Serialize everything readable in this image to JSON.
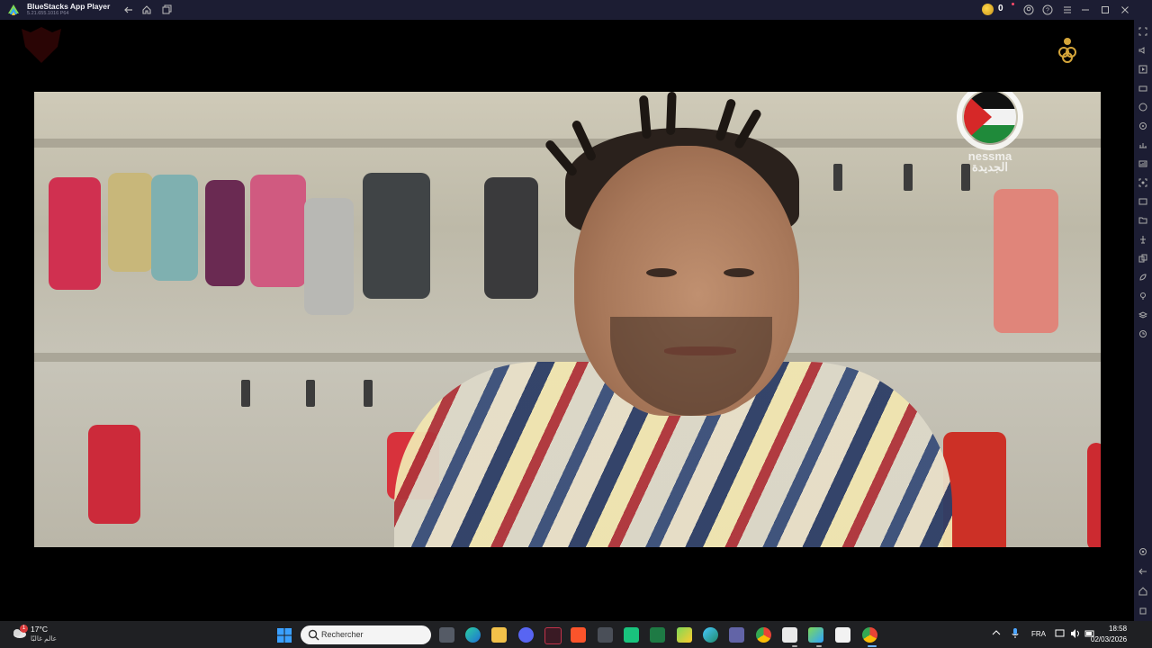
{
  "window": {
    "title": "BlueStacks App Player",
    "version": "5.21.655.1016 P64",
    "coins": "0"
  },
  "titlebar_icons": [
    "back-icon",
    "home-icon",
    "multi-instance-icon",
    "coin-icon",
    "account-icon",
    "help-icon",
    "menu-icon",
    "minimize-icon",
    "restore-icon",
    "close-icon"
  ],
  "sidebar_icons": [
    "fullscreen-icon",
    "volume-icon",
    "media-icon",
    "keyboard-icon",
    "gamepad-icon",
    "controls-icon",
    "performance-icon",
    "macro-icon",
    "screenshot-icon",
    "folder-icon",
    "rotate-icon",
    "multi-instance-icon",
    "eco-mode-icon",
    "location-icon",
    "layers-icon",
    "sync-icon",
    "settings-icon",
    "back-icon",
    "home-icon",
    "recent-apps-icon"
  ],
  "video": {
    "channel_name": "nessma\nالجديدة"
  },
  "taskbar": {
    "weather_temp": "17°C",
    "weather_desc": "عالم غالبًا",
    "weather_badge": "1",
    "search_placeholder": "Rechercher",
    "apps": [
      "task-view",
      "edge",
      "file-explorer",
      "discord",
      "vpn-app",
      "brave",
      "calculator",
      "app-green",
      "excel",
      "bluestacks-store",
      "edge-alt",
      "teams",
      "chrome",
      "terminal",
      "bluestacks",
      "capcut",
      "chrome-active"
    ],
    "language": "FRA",
    "time": "18:58",
    "date": "02/03/2026"
  }
}
